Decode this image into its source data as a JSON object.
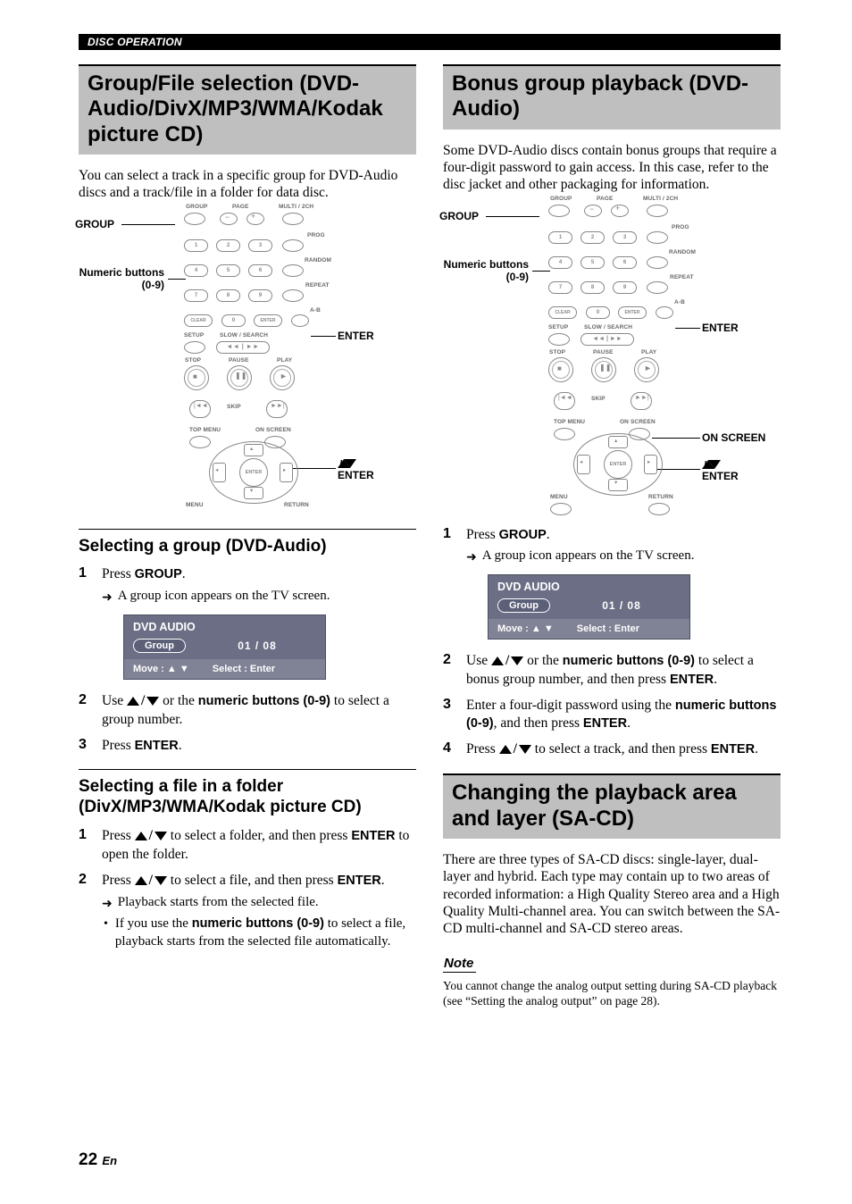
{
  "header": {
    "section": "DISC OPERATION"
  },
  "left": {
    "title": "Group/File selection (DVD-Audio/DivX/MP3/WMA/Kodak picture CD)",
    "intro": "You can select a track in a specific group for DVD-Audio discs and a track/file in a folder for data disc.",
    "remote_labels": {
      "group": "GROUP",
      "numeric": "Numeric buttons (0-9)",
      "enter_side": "ENTER",
      "updown_enter": "ENTER"
    },
    "section_a": {
      "heading": "Selecting a group (DVD-Audio)",
      "steps": {
        "s1": {
          "n": "1",
          "text_pre": "Press ",
          "btn": "GROUP",
          "text_post": ".",
          "result": "A group icon appears on the TV screen."
        },
        "s2": {
          "n": "2",
          "text_pre": "Use ",
          "text_mid": " or the ",
          "btn": "numeric buttons (0-9)",
          "text_post": " to select a group number."
        },
        "s3": {
          "n": "3",
          "text_pre": "Press ",
          "btn": "ENTER",
          "text_post": "."
        }
      },
      "osd": {
        "title": "DVD AUDIO",
        "chip": "Group",
        "value": "01 / 08",
        "hint_move": "Move :  ▲ ▼",
        "hint_select": "Select :  Enter"
      }
    },
    "section_b": {
      "heading": "Selecting a file in a folder (DivX/MP3/WMA/Kodak picture CD)",
      "steps": {
        "s1": {
          "n": "1",
          "text_pre": "Press ",
          "text_mid": " to select a folder, and then press ",
          "btn": "ENTER",
          "text_post": " to open the folder."
        },
        "s2": {
          "n": "2",
          "text_pre": "Press ",
          "text_mid": " to select a file, and then press ",
          "btn": "ENTER",
          "text_post": ".",
          "r1": "Playback starts from the selected file.",
          "r2_pre": "If you use the ",
          "r2_btn": "numeric buttons (0-9)",
          "r2_post": " to select a file, playback starts from the selected file automatically."
        }
      }
    }
  },
  "right": {
    "title1": "Bonus group playback (DVD-Audio)",
    "intro1": "Some DVD-Audio discs contain bonus groups that require a four-digit password to gain access. In this case, refer to the disc jacket and other packaging for information.",
    "remote_labels": {
      "group": "GROUP",
      "numeric": "Numeric buttons (0-9)",
      "enter_side": "ENTER",
      "on_screen": "ON SCREEN",
      "updown_enter": "ENTER"
    },
    "steps1": {
      "s1": {
        "n": "1",
        "text_pre": "Press ",
        "btn": "GROUP",
        "text_post": ".",
        "result": "A group icon appears on the TV screen."
      },
      "s2": {
        "n": "2",
        "text_pre": "Use ",
        "text_mid": " or the ",
        "btn": "numeric buttons (0-9)",
        "text_post": " to select a bonus group number, and then press ",
        "btn2": "ENTER",
        "text_end": "."
      },
      "s3": {
        "n": "3",
        "text_pre": "Enter a four-digit password using the ",
        "btn": "numeric buttons (0-9)",
        "text_mid": ", and then press ",
        "btn2": "ENTER",
        "text_post": "."
      },
      "s4": {
        "n": "4",
        "text_pre": "Press ",
        "text_mid": " to select a track, and then press ",
        "btn": "ENTER",
        "text_post": "."
      }
    },
    "osd": {
      "title": "DVD AUDIO",
      "chip": "Group",
      "value": "01 / 08",
      "hint_move": "Move :  ▲ ▼",
      "hint_select": "Select :  Enter"
    },
    "title2": "Changing the playback area and layer (SA-CD)",
    "intro2": "There are three types of SA-CD discs: single-layer, dual-layer and hybrid. Each type may contain up to two areas of recorded information: a High Quality Stereo area and a High Quality Multi-channel area. You can switch between the SA-CD multi-channel and SA-CD stereo areas.",
    "note_label": "Note",
    "note_body": "You cannot change the analog output setting during SA-CD playback (see “Setting the analog output” on page 28)."
  },
  "remote": {
    "row_labels_top": {
      "group": "GROUP",
      "page": "PAGE",
      "multi": "MULTI / 2CH"
    },
    "side_labels": {
      "prog": "PROG",
      "random": "RANDOM",
      "repeat": "REPEAT",
      "ab": "A-B"
    },
    "num": [
      "1",
      "2",
      "3",
      "4",
      "5",
      "6",
      "7",
      "8",
      "9",
      "0"
    ],
    "clear": "CLEAR",
    "enter_small": "ENTER",
    "setup": "SETUP",
    "slow": "SLOW / SEARCH",
    "stop": "STOP",
    "pause": "PAUSE",
    "play": "PLAY",
    "skip": "SKIP",
    "topmenu": "TOP MENU",
    "onscreen": "ON SCREEN",
    "menu": "MENU",
    "return": "RETURN",
    "dpad_enter": "ENTER"
  },
  "footer": {
    "page": "22",
    "lang": "En"
  }
}
